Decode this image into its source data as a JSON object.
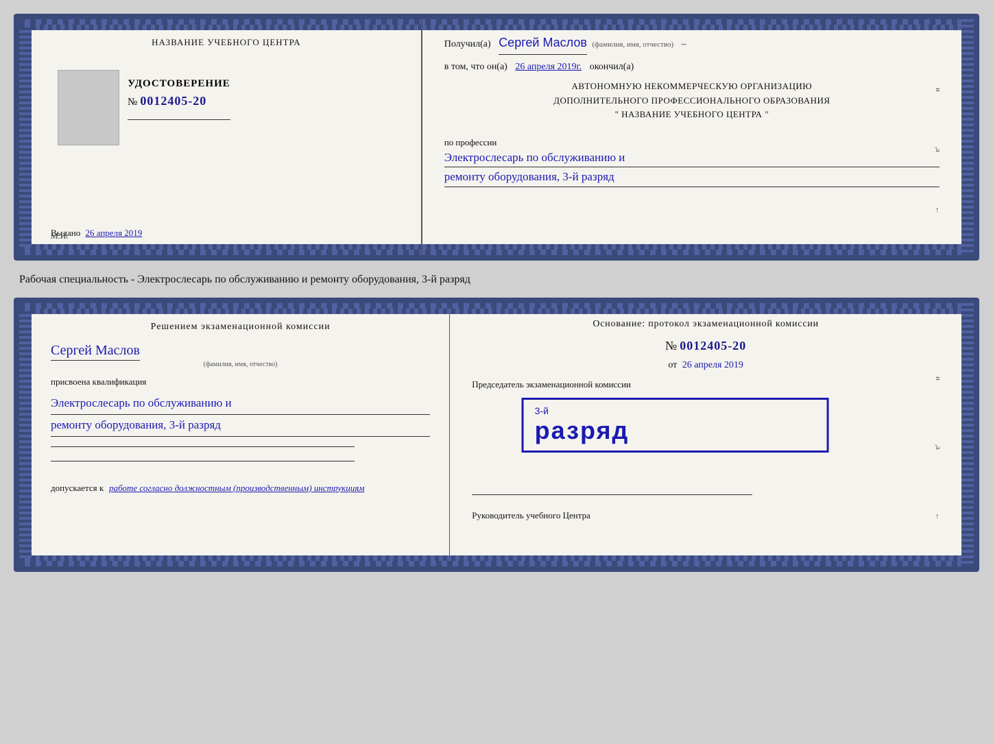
{
  "cert1": {
    "left": {
      "org_title": "НАЗВАНИЕ УЧЕБНОГО ЦЕНТРА",
      "cert_label": "УДОСТОВЕРЕНИЕ",
      "cert_number_prefix": "№",
      "cert_number": "0012405-20",
      "issued_label": "Выдано",
      "issued_date": "26 апреля 2019",
      "stamp_label": "М.П."
    },
    "right": {
      "received_prefix": "Получил(а)",
      "received_name": "Сергей Маслов",
      "fio_label": "(фамилия, имя, отчество)",
      "date_prefix": "в том, что он(а)",
      "date_value": "26 апреля 2019г.",
      "finished_label": "окончил(а)",
      "org_line1": "АВТОНОМНУЮ НЕКОММЕРЧЕСКУЮ ОРГАНИЗАЦИЮ",
      "org_line2": "ДОПОЛНИТЕЛЬНОГО ПРОФЕССИОНАЛЬНОГО ОБРАЗОВАНИЯ",
      "org_line3": "\"  НАЗВАНИЕ УЧЕБНОГО ЦЕНТРА  \"",
      "profession_prefix": "по профессии",
      "profession_line1": "Электрослесарь по обслуживанию и",
      "profession_line2": "ремонту оборудования, 3-й разряд"
    }
  },
  "between_label": "Рабочая специальность - Электрослесарь по обслуживанию и ремонту оборудования, 3-й разряд",
  "cert2": {
    "left": {
      "decision_title": "Решением экзаменационной комиссии",
      "name": "Сергей Маслов",
      "fio_label": "(фамилия, имя, отчество)",
      "assigned_label": "присвоена квалификация",
      "qual_line1": "Электрослесарь по обслуживанию и",
      "qual_line2": "ремонту оборудования, 3-й разряд",
      "allows_prefix": "допускается к",
      "allows_text": "работе согласно должностным (производственным) инструкциям"
    },
    "right": {
      "basis_label": "Основание: протокол экзаменационной комиссии",
      "number_prefix": "№",
      "number": "0012405-20",
      "date_prefix": "от",
      "date_value": "26 апреля 2019",
      "chairman_label": "Председатель экзаменационной комиссии",
      "stamp_pre": "3-й",
      "stamp_text": "разряд",
      "head_label": "Руководитель учебного Центра"
    }
  }
}
